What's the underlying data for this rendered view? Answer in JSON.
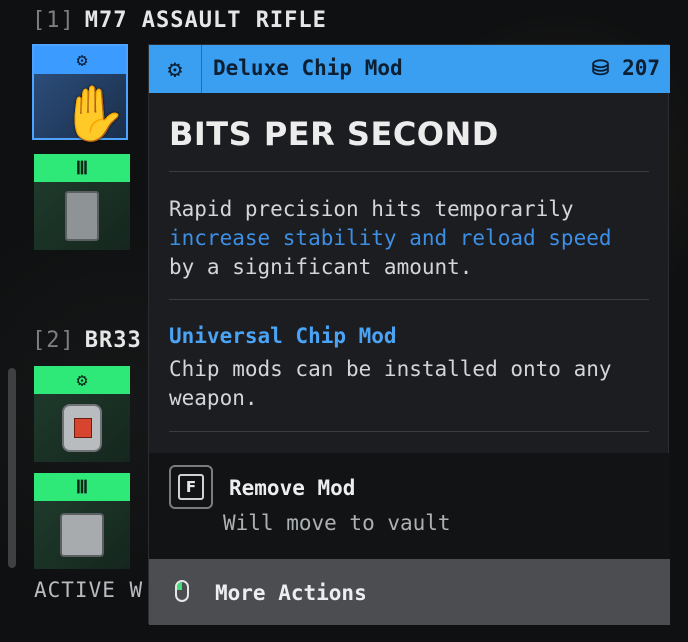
{
  "weapons": [
    {
      "index": "[1]",
      "name": "M77 ASSAULT RIFLE"
    },
    {
      "index": "[2]",
      "name": "BR33"
    }
  ],
  "slot_icons": {
    "chip": "⚙",
    "mag": "Ⅲ"
  },
  "active_label": "ACTIVE W",
  "tooltip": {
    "type_label": "Deluxe Chip Mod",
    "cost_icon": "⛁",
    "cost_value": "207",
    "title": "BITS PER SECOND",
    "description": {
      "part1": "Rapid precision hits temporarily ",
      "highlight": "increase stability and reload speed",
      "part2": " by a significant amount."
    },
    "subheading": "Universal Chip Mod",
    "subtext": "Chip mods can be installed onto any weapon.",
    "actions": {
      "remove_key": "F",
      "remove_label": "Remove Mod",
      "remove_sub": "Will move to vault",
      "more_label": "More Actions"
    }
  },
  "colors": {
    "accent_blue": "#3a9ff0",
    "slot_green": "#2ee878",
    "highlight_blue": "#3d8fe6"
  }
}
